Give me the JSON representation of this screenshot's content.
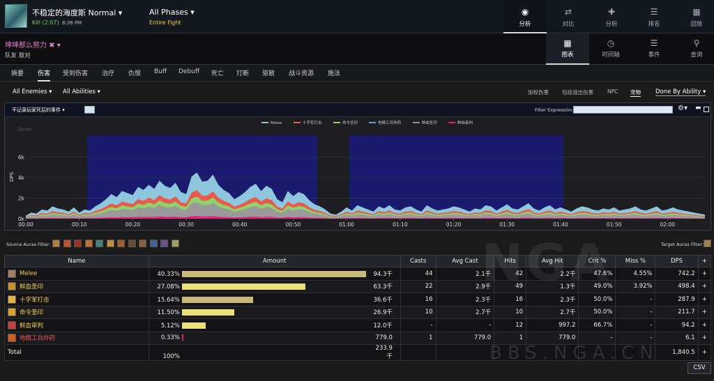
{
  "header": {
    "boss_name": "不稳定的海度斯 Normal ▾",
    "kill_status": "Kill (2:07)",
    "kill_time": "8:36 PM",
    "phase_label": "All Phases ▾",
    "phase_sub": "Entire Fight",
    "nav": [
      {
        "label": "分析",
        "icon": "eye-icon",
        "active": true
      },
      {
        "label": "对比",
        "icon": "compare-icon",
        "active": false
      },
      {
        "label": "分析",
        "icon": "puzzle-icon",
        "active": false
      },
      {
        "label": "排名",
        "icon": "ranking-icon",
        "active": false
      },
      {
        "label": "回放",
        "icon": "replay-icon",
        "active": false
      }
    ]
  },
  "player": {
    "name": "坤坤那么努力 ✖ ▾",
    "sub": "队友  敌对"
  },
  "views": [
    {
      "label": "图表",
      "icon": "grid-icon",
      "active": true
    },
    {
      "label": "时间轴",
      "icon": "clock-icon",
      "active": false
    },
    {
      "label": "事件",
      "icon": "list-icon",
      "active": false
    },
    {
      "label": "查询",
      "icon": "pin-icon",
      "active": false
    }
  ],
  "tabs": [
    "摘要",
    "伤害",
    "受到伤害",
    "治疗",
    "仇恨",
    "Buff",
    "Debuff",
    "死亡",
    "打断",
    "驱散",
    "战斗资源",
    "施法"
  ],
  "active_tab": "伤害",
  "filters": {
    "enemies": "All Enemies ▾",
    "abilities": "All Abilities ▾",
    "right": [
      "加权伤害",
      "包括溢出伤害",
      "NPC",
      "宠物"
    ],
    "done_by": "Done By Ability ▾"
  },
  "chart_header": {
    "left": "不记录玩家死后的事件 ▾",
    "filter_label": "Filter Expression:"
  },
  "chart_data": {
    "type": "area",
    "zoom_label": "Zoom",
    "ylabel": "DPS",
    "yticks": [
      "0k",
      "2k",
      "4k",
      "6k"
    ],
    "ylim": [
      0,
      8000
    ],
    "xticks": [
      "00:00",
      "00:10",
      "00:20",
      "00:30",
      "00:40",
      "00:50",
      "01:00",
      "01:10",
      "01:20",
      "01:30",
      "01:40",
      "01:50",
      "02:00"
    ],
    "x_seconds": [
      0,
      127
    ],
    "phases": [
      {
        "start": 11.5,
        "end": 54.5,
        "color": "#1a1a6e"
      },
      {
        "start": 60.5,
        "end": 100.5,
        "color": "#1a1a6e"
      }
    ],
    "legend": [
      {
        "name": "Melee",
        "color": "#8ec6dd"
      },
      {
        "name": "十字军打击",
        "color": "#e95a4a"
      },
      {
        "name": "命令圣印",
        "color": "#8fd36b"
      },
      {
        "name": "地精工兵炸药",
        "color": "#6aa0d8"
      },
      {
        "name": "鲜血圣印",
        "color": "#9a9a9a"
      },
      {
        "name": "鲜血审判",
        "color": "#e0237a"
      }
    ],
    "series_total": [
      300,
      600,
      500,
      900,
      800,
      1200,
      1000,
      900,
      700,
      1100,
      600,
      900,
      800,
      1200,
      1500,
      1900,
      2400,
      2100,
      2700,
      2500,
      2300,
      3100,
      2800,
      3300,
      2900,
      3700,
      3200,
      3000,
      3500,
      2600,
      2400,
      4100,
      4500,
      3600,
      3700,
      4300,
      3300,
      2800,
      2500,
      1900,
      2200,
      2600,
      3100,
      3400,
      2700,
      3200,
      2900,
      1900,
      1600,
      2700,
      2200,
      2600,
      2400,
      1800,
      1400,
      1200,
      900,
      500,
      400,
      700,
      1100,
      800,
      1300,
      1100,
      900,
      700,
      1200,
      1000,
      1300,
      900,
      800,
      1100,
      1200,
      900,
      700,
      1300,
      1000,
      800,
      900,
      1000,
      1200,
      1100,
      900,
      700,
      1000,
      900,
      1300,
      1200,
      800,
      1100,
      1400,
      1000,
      900,
      1200,
      1500,
      1000,
      800,
      1100,
      1300,
      900,
      1100,
      900,
      700,
      1000,
      1200,
      1100,
      900,
      800,
      1000,
      900,
      1100,
      800,
      900,
      1000,
      1200,
      900,
      800,
      1000,
      1200,
      800,
      900,
      1100,
      900,
      800,
      700,
      600,
      500,
      400
    ]
  },
  "auras": {
    "source_label": "Source Auras Filter:",
    "source_icons": [
      "aura-icon-1",
      "aura-icon-2",
      "aura-icon-3",
      "aura-icon-4",
      "aura-icon-5",
      "aura-icon-6",
      "aura-icon-7",
      "aura-icon-8",
      "aura-icon-9",
      "aura-icon-10",
      "aura-icon-11",
      "aura-icon-12"
    ],
    "target_label": "Target Auras Filter:"
  },
  "table": {
    "headers": [
      "Name",
      "Amount",
      "Casts",
      "Avg Cast",
      "Hits",
      "Avg Hit",
      "Crit %",
      "Miss %",
      "DPS",
      "+"
    ],
    "rows": [
      {
        "name": "Melee",
        "icon": "melee-icon",
        "name_color": "#f3d24a",
        "pct": "40.33%",
        "bar": 0.4033,
        "bar_color": "#c9b97a",
        "amount": "94.3千",
        "casts": "44",
        "avg_cast": "2.1千",
        "hits": "42",
        "avg_hit": "2.2千",
        "crit": "47.6%",
        "miss": "4.55%",
        "dps": "742.2"
      },
      {
        "name": "鲜血圣印",
        "icon": "seal-of-blood-icon",
        "name_color": "#f3d24a",
        "pct": "27.08%",
        "bar": 0.2708,
        "bar_color": "#e9e07a",
        "amount": "63.3千",
        "casts": "22",
        "avg_cast": "2.9千",
        "hits": "49",
        "avg_hit": "1.3千",
        "crit": "49.0%",
        "miss": "3.92%",
        "dps": "498.4"
      },
      {
        "name": "十字军打击",
        "icon": "crusader-strike-icon",
        "name_color": "#f3d24a",
        "pct": "15.64%",
        "bar": 0.1564,
        "bar_color": "#c9b97a",
        "amount": "36.6千",
        "casts": "16",
        "avg_cast": "2.3千",
        "hits": "16",
        "avg_hit": "2.3千",
        "crit": "50.0%",
        "miss": "-",
        "dps": "287.9"
      },
      {
        "name": "命令圣印",
        "icon": "seal-of-command-icon",
        "name_color": "#f3d24a",
        "pct": "11.50%",
        "bar": 0.115,
        "bar_color": "#e9e07a",
        "amount": "26.9千",
        "casts": "10",
        "avg_cast": "2.7千",
        "hits": "10",
        "avg_hit": "2.7千",
        "crit": "50.0%",
        "miss": "-",
        "dps": "211.7"
      },
      {
        "name": "鲜血审判",
        "icon": "judgement-of-blood-icon",
        "name_color": "#f3d24a",
        "pct": "5.12%",
        "bar": 0.0512,
        "bar_color": "#e9e07a",
        "amount": "12.0千",
        "casts": "-",
        "avg_cast": "-",
        "hits": "12",
        "avg_hit": "997.2",
        "crit": "66.7%",
        "miss": "-",
        "dps": "94.2"
      },
      {
        "name": "地精工兵炸药",
        "icon": "goblin-sapper-icon",
        "name_color": "#e85a4a",
        "pct": "0.33%",
        "bar": 0.0033,
        "bar_color": "#e0237a",
        "amount": "779.0",
        "casts": "1",
        "avg_cast": "779.0",
        "hits": "1",
        "avg_hit": "779.0",
        "crit": "-",
        "miss": "-",
        "dps": "6.1"
      }
    ],
    "total": {
      "label": "Total",
      "pct": "100%",
      "amount": "233.9千",
      "dps": "1,840.5"
    }
  },
  "csv_label": "CSV",
  "watermark": {
    "logo": "NGA",
    "site": "BBS.NGA.CN"
  }
}
